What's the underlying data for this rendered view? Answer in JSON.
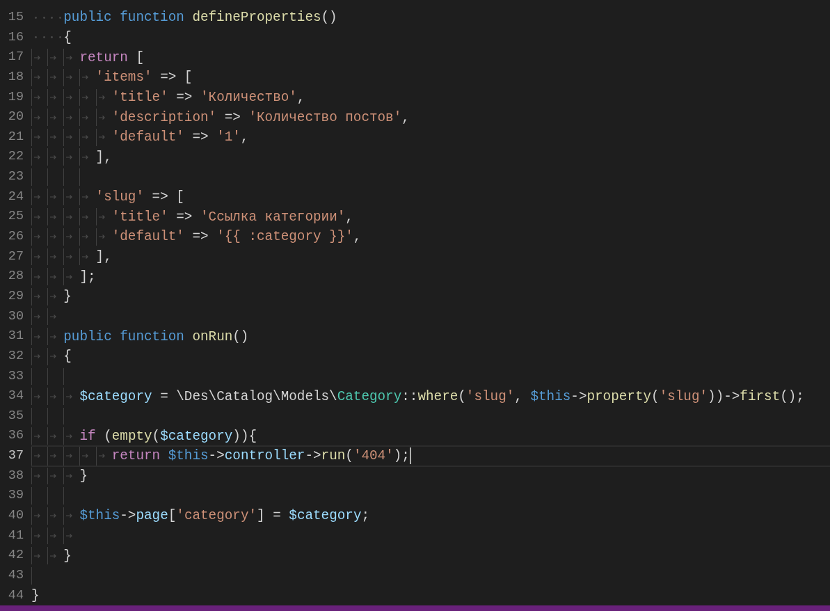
{
  "editor": {
    "lines": [
      {
        "number": "15",
        "active": false,
        "indent": [
          {
            "kind": "space"
          },
          {
            "kind": "space"
          },
          {
            "kind": "space"
          },
          {
            "kind": "space"
          }
        ],
        "tokens": [
          {
            "kind": "kw",
            "text": "public function "
          },
          {
            "kind": "fn",
            "text": "defineProperties"
          },
          {
            "kind": "plain",
            "text": "()"
          }
        ]
      },
      {
        "number": "16",
        "active": false,
        "indent": [
          {
            "kind": "space"
          },
          {
            "kind": "space"
          },
          {
            "kind": "space"
          },
          {
            "kind": "space"
          }
        ],
        "tokens": [
          {
            "kind": "plain",
            "text": "{"
          }
        ]
      },
      {
        "number": "17",
        "active": false,
        "indent": [
          {
            "kind": "tab"
          },
          {
            "kind": "tab"
          },
          {
            "kind": "tab"
          }
        ],
        "tokens": [
          {
            "kind": "ctrl",
            "text": "return"
          },
          {
            "kind": "plain",
            "text": " ["
          }
        ]
      },
      {
        "number": "18",
        "active": false,
        "indent": [
          {
            "kind": "tab"
          },
          {
            "kind": "tab"
          },
          {
            "kind": "tab"
          },
          {
            "kind": "tab"
          }
        ],
        "tokens": [
          {
            "kind": "str",
            "text": "'items'"
          },
          {
            "kind": "plain",
            "text": " => ["
          }
        ]
      },
      {
        "number": "19",
        "active": false,
        "indent": [
          {
            "kind": "tab"
          },
          {
            "kind": "tab"
          },
          {
            "kind": "tab"
          },
          {
            "kind": "tab"
          },
          {
            "kind": "tab"
          }
        ],
        "tokens": [
          {
            "kind": "str",
            "text": "'title'"
          },
          {
            "kind": "plain",
            "text": " => "
          },
          {
            "kind": "str",
            "text": "'Количество'"
          },
          {
            "kind": "plain",
            "text": ","
          }
        ]
      },
      {
        "number": "20",
        "active": false,
        "indent": [
          {
            "kind": "tab"
          },
          {
            "kind": "tab"
          },
          {
            "kind": "tab"
          },
          {
            "kind": "tab"
          },
          {
            "kind": "tab"
          }
        ],
        "tokens": [
          {
            "kind": "str",
            "text": "'description'"
          },
          {
            "kind": "plain",
            "text": " => "
          },
          {
            "kind": "str",
            "text": "'Количество постов'"
          },
          {
            "kind": "plain",
            "text": ","
          }
        ]
      },
      {
        "number": "21",
        "active": false,
        "indent": [
          {
            "kind": "tab"
          },
          {
            "kind": "tab"
          },
          {
            "kind": "tab"
          },
          {
            "kind": "tab"
          },
          {
            "kind": "tab"
          }
        ],
        "tokens": [
          {
            "kind": "str",
            "text": "'default'"
          },
          {
            "kind": "plain",
            "text": " => "
          },
          {
            "kind": "str",
            "text": "'1'"
          },
          {
            "kind": "plain",
            "text": ","
          }
        ]
      },
      {
        "number": "22",
        "active": false,
        "indent": [
          {
            "kind": "tab"
          },
          {
            "kind": "tab"
          },
          {
            "kind": "tab"
          },
          {
            "kind": "tab"
          }
        ],
        "tokens": [
          {
            "kind": "plain",
            "text": "],"
          }
        ]
      },
      {
        "number": "23",
        "active": false,
        "indent": [
          {
            "kind": "guide"
          },
          {
            "kind": "guide"
          },
          {
            "kind": "guide"
          },
          {
            "kind": "guide"
          }
        ]
      },
      {
        "number": "24",
        "active": false,
        "indent": [
          {
            "kind": "tab"
          },
          {
            "kind": "tab"
          },
          {
            "kind": "tab"
          },
          {
            "kind": "tab"
          }
        ],
        "tokens": [
          {
            "kind": "str",
            "text": "'slug'"
          },
          {
            "kind": "plain",
            "text": " => ["
          }
        ]
      },
      {
        "number": "25",
        "active": false,
        "indent": [
          {
            "kind": "tab"
          },
          {
            "kind": "tab"
          },
          {
            "kind": "tab"
          },
          {
            "kind": "tab"
          },
          {
            "kind": "tab"
          }
        ],
        "tokens": [
          {
            "kind": "str",
            "text": "'title'"
          },
          {
            "kind": "plain",
            "text": " => "
          },
          {
            "kind": "str",
            "text": "'Ссылка категории'"
          },
          {
            "kind": "plain",
            "text": ","
          }
        ]
      },
      {
        "number": "26",
        "active": false,
        "indent": [
          {
            "kind": "tab"
          },
          {
            "kind": "tab"
          },
          {
            "kind": "tab"
          },
          {
            "kind": "tab"
          },
          {
            "kind": "tab"
          }
        ],
        "tokens": [
          {
            "kind": "str",
            "text": "'default'"
          },
          {
            "kind": "plain",
            "text": " => "
          },
          {
            "kind": "str",
            "text": "'{{ :category }}'"
          },
          {
            "kind": "plain",
            "text": ","
          }
        ]
      },
      {
        "number": "27",
        "active": false,
        "indent": [
          {
            "kind": "tab"
          },
          {
            "kind": "tab"
          },
          {
            "kind": "tab"
          },
          {
            "kind": "tab"
          }
        ],
        "tokens": [
          {
            "kind": "plain",
            "text": "],"
          }
        ]
      },
      {
        "number": "28",
        "active": false,
        "indent": [
          {
            "kind": "tab"
          },
          {
            "kind": "tab"
          },
          {
            "kind": "tab"
          }
        ],
        "tokens": [
          {
            "kind": "plain",
            "text": "];"
          }
        ]
      },
      {
        "number": "29",
        "active": false,
        "indent": [
          {
            "kind": "tab"
          },
          {
            "kind": "tab"
          }
        ],
        "tokens": [
          {
            "kind": "plain",
            "text": "}"
          }
        ]
      },
      {
        "number": "30",
        "active": false,
        "indent": [
          {
            "kind": "tab"
          },
          {
            "kind": "tab"
          }
        ]
      },
      {
        "number": "31",
        "active": false,
        "indent": [
          {
            "kind": "tab"
          },
          {
            "kind": "tab"
          }
        ],
        "tokens": [
          {
            "kind": "kw",
            "text": "public function "
          },
          {
            "kind": "fn",
            "text": "onRun"
          },
          {
            "kind": "plain",
            "text": "()"
          }
        ]
      },
      {
        "number": "32",
        "active": false,
        "indent": [
          {
            "kind": "tab"
          },
          {
            "kind": "tab"
          }
        ],
        "tokens": [
          {
            "kind": "plain",
            "text": "{"
          }
        ]
      },
      {
        "number": "33",
        "active": false,
        "indent": [
          {
            "kind": "guide"
          },
          {
            "kind": "guide"
          },
          {
            "kind": "guide"
          }
        ]
      },
      {
        "number": "34",
        "active": false,
        "indent": [
          {
            "kind": "tab"
          },
          {
            "kind": "tab"
          },
          {
            "kind": "tab"
          }
        ],
        "tokens": [
          {
            "kind": "var",
            "text": "$category"
          },
          {
            "kind": "plain",
            "text": " = \\Des\\Catalog\\Models\\"
          },
          {
            "kind": "type",
            "text": "Category"
          },
          {
            "kind": "plain",
            "text": "::"
          },
          {
            "kind": "fn",
            "text": "where"
          },
          {
            "kind": "plain",
            "text": "("
          },
          {
            "kind": "str",
            "text": "'slug'"
          },
          {
            "kind": "plain",
            "text": ", "
          },
          {
            "kind": "this",
            "text": "$this"
          },
          {
            "kind": "plain",
            "text": "->"
          },
          {
            "kind": "fn",
            "text": "property"
          },
          {
            "kind": "plain",
            "text": "("
          },
          {
            "kind": "str",
            "text": "'slug'"
          },
          {
            "kind": "plain",
            "text": "))->"
          },
          {
            "kind": "fn",
            "text": "first"
          },
          {
            "kind": "plain",
            "text": "();"
          }
        ]
      },
      {
        "number": "35",
        "active": false,
        "indent": [
          {
            "kind": "guide"
          },
          {
            "kind": "guide"
          },
          {
            "kind": "guide"
          }
        ]
      },
      {
        "number": "36",
        "active": false,
        "indent": [
          {
            "kind": "tab"
          },
          {
            "kind": "tab"
          },
          {
            "kind": "tab"
          }
        ],
        "tokens": [
          {
            "kind": "ctrl",
            "text": "if"
          },
          {
            "kind": "plain",
            "text": " ("
          },
          {
            "kind": "fn",
            "text": "empty"
          },
          {
            "kind": "plain",
            "text": "("
          },
          {
            "kind": "var",
            "text": "$category"
          },
          {
            "kind": "plain",
            "text": ")){"
          }
        ]
      },
      {
        "number": "37",
        "active": true,
        "indent": [
          {
            "kind": "tab"
          },
          {
            "kind": "tab"
          },
          {
            "kind": "tab"
          },
          {
            "kind": "tab"
          },
          {
            "kind": "tab"
          }
        ],
        "tokens": [
          {
            "kind": "ctrl",
            "text": "return"
          },
          {
            "kind": "this",
            "text": " $this"
          },
          {
            "kind": "plain",
            "text": "->"
          },
          {
            "kind": "var",
            "text": "controller"
          },
          {
            "kind": "plain",
            "text": "->"
          },
          {
            "kind": "fn",
            "text": "run"
          },
          {
            "kind": "plain",
            "text": "("
          },
          {
            "kind": "str",
            "text": "'404'"
          },
          {
            "kind": "plain",
            "text": ");"
          }
        ]
      },
      {
        "number": "38",
        "active": false,
        "indent": [
          {
            "kind": "tab"
          },
          {
            "kind": "tab"
          },
          {
            "kind": "tab"
          }
        ],
        "tokens": [
          {
            "kind": "plain",
            "text": "}"
          }
        ]
      },
      {
        "number": "39",
        "active": false,
        "indent": [
          {
            "kind": "guide"
          },
          {
            "kind": "guide"
          },
          {
            "kind": "guide"
          }
        ]
      },
      {
        "number": "40",
        "active": false,
        "indent": [
          {
            "kind": "tab"
          },
          {
            "kind": "tab"
          },
          {
            "kind": "tab"
          }
        ],
        "tokens": [
          {
            "kind": "this",
            "text": "$this"
          },
          {
            "kind": "plain",
            "text": "->"
          },
          {
            "kind": "var",
            "text": "page"
          },
          {
            "kind": "plain",
            "text": "["
          },
          {
            "kind": "str",
            "text": "'category'"
          },
          {
            "kind": "plain",
            "text": "] = "
          },
          {
            "kind": "var",
            "text": "$category"
          },
          {
            "kind": "plain",
            "text": ";"
          }
        ]
      },
      {
        "number": "41",
        "active": false,
        "indent": [
          {
            "kind": "tab"
          },
          {
            "kind": "tab"
          },
          {
            "kind": "tab"
          }
        ]
      },
      {
        "number": "42",
        "active": false,
        "indent": [
          {
            "kind": "tab"
          },
          {
            "kind": "tab"
          }
        ],
        "tokens": [
          {
            "kind": "plain",
            "text": "}"
          }
        ]
      },
      {
        "number": "43",
        "active": false,
        "indent": [
          {
            "kind": "guide"
          }
        ]
      },
      {
        "number": "44",
        "active": false,
        "tokens": [
          {
            "kind": "plain",
            "text": "}"
          }
        ]
      }
    ]
  }
}
